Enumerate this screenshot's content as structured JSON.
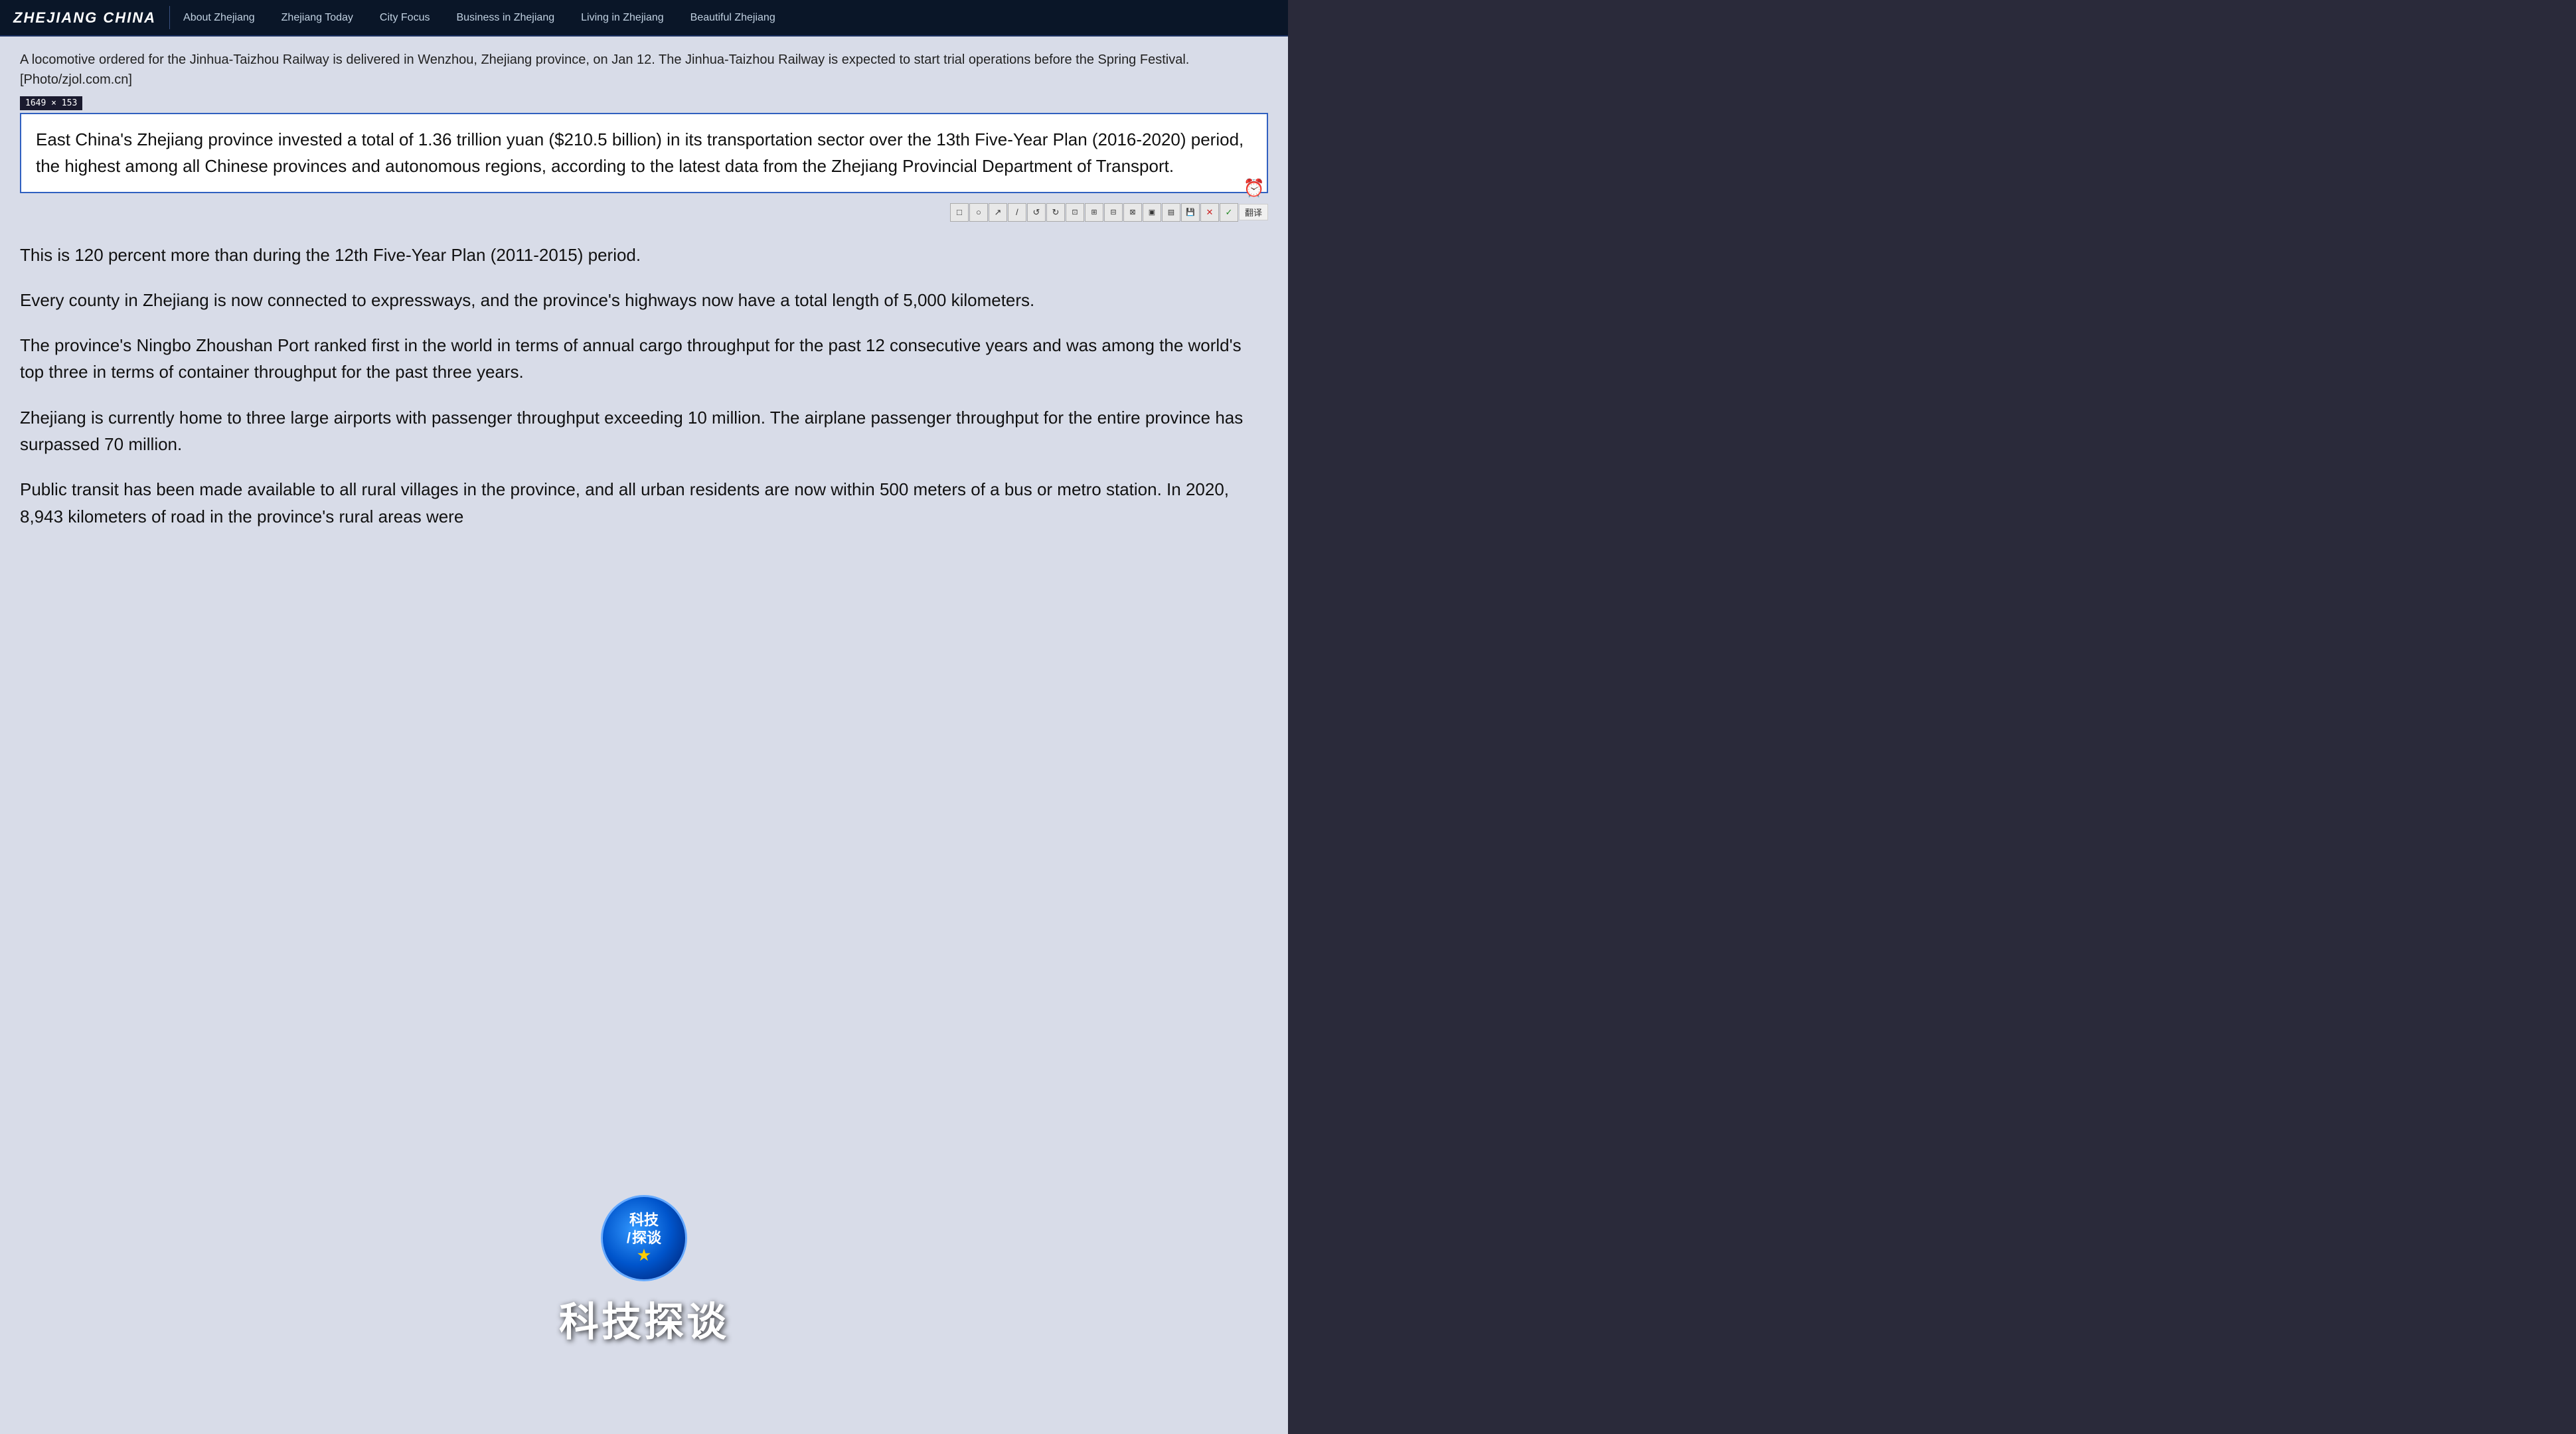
{
  "site": {
    "title": "ZHEJIANG CHINA"
  },
  "nav": {
    "links": [
      {
        "label": "About Zhejiang",
        "id": "about"
      },
      {
        "label": "Zhejiang Today",
        "id": "today"
      },
      {
        "label": "City Focus",
        "id": "city"
      },
      {
        "label": "Business in Zhejiang",
        "id": "business"
      },
      {
        "label": "Living in Zhejiang",
        "id": "living"
      },
      {
        "label": "Beautiful Zhejiang",
        "id": "beautiful"
      }
    ]
  },
  "content": {
    "caption": "A locomotive ordered for the Jinhua-Taizhou Railway is delivered in Wenzhou, Zhejiang province, on Jan 12. The Jinhua-Taizhou Railway is expected to start trial operations before the Spring Festival. [Photo/zjol.com.cn]",
    "dimension_badge": "1649 × 153",
    "selected_paragraph": "East China's Zhejiang province invested a total of 1.36 trillion yuan ($210.5 billion) in its transportation sector over the 13th Five-Year Plan (2016-2020) period, the highest among all Chinese provinces and autonomous regions, according to the latest data from the Zhejiang Provincial Department of Transport.",
    "paragraphs": [
      "This is 120 percent more than during the 12th Five-Year Plan (2011-2015) period.",
      "Every county in Zhejiang is now connected to expressways, and the province's highways now have a total length of 5,000 kilometers.",
      "The province's Ningbo Zhoushan Port ranked first in the world in terms of annual cargo throughput for the past 12 consecutive years and was among the world's top three in terms of container throughput for the past three years.",
      "Zhejiang is currently home to three large airports with passenger throughput exceeding 10 million. The airplane passenger throughput for the entire province has surpassed 70 million.",
      "Public transit has been made available to all rural villages in the province, and all urban residents are now within 500 meters of a bus or metro station. In 2020, 8,943 kilometers of road in the province's rural areas were"
    ]
  },
  "toolbar": {
    "icons": [
      "□",
      "○",
      "↗",
      "/",
      "↺",
      "↻",
      "⊡",
      "⊞",
      "⊟",
      "⊠",
      "⊡",
      "▣",
      "💾",
      "✕",
      "✓"
    ],
    "translate_label": "翻译"
  },
  "floating": {
    "circle_line1": "科技",
    "circle_line2": "探谈",
    "bottom_label": "科技探谈"
  }
}
